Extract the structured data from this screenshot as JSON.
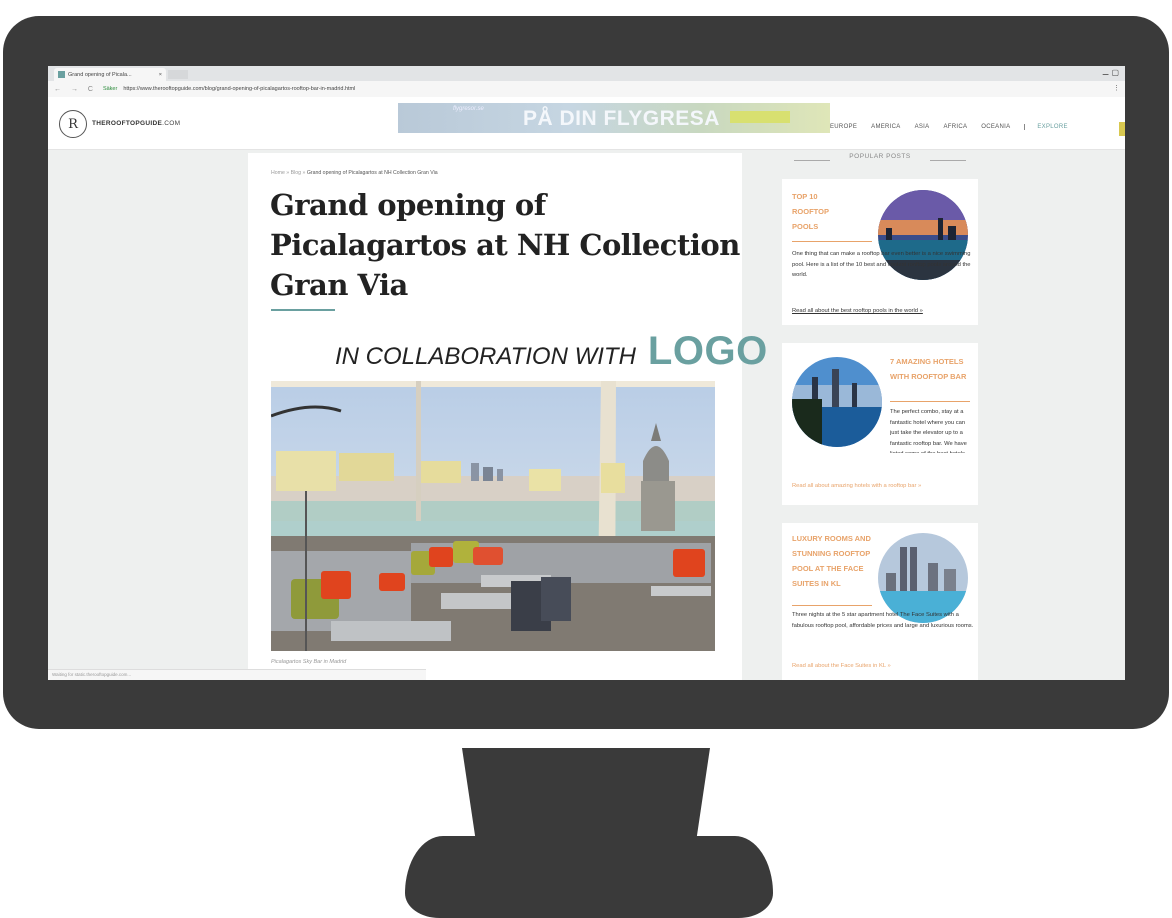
{
  "browser": {
    "tab_title": "Grand opening of Picala...",
    "tab_close": "×",
    "window_controls": "⚊ ▢",
    "nav_buttons": "← → C",
    "secure_label": "Säker",
    "url": "https://www.therooftopguide.com/blog/grand-opening-of-picalagartos-rooftop-bar-in-madrid.html",
    "menu": "⋮"
  },
  "site": {
    "logo_mark": "R",
    "logo_text_bold": "THEROOFTOPGUIDE",
    "logo_text_rest": ".COM",
    "ad_banner_sub": "flygresor.se",
    "ad_banner_text": "PÅ DIN FLYGRESA",
    "nav": [
      "EUROPE",
      "AMERICA",
      "ASIA",
      "AFRICA",
      "OCEANIA"
    ],
    "explore": "EXPLORE"
  },
  "article": {
    "breadcrumb": [
      "Home",
      "Blog",
      "Grand opening of Picalagartos at NH Collection Gran Via"
    ],
    "breadcrumb_sep": "»",
    "title": "Grand opening of Picalagartos at NH Collection Gran Via",
    "collab_text": "IN COLLABORATION WITH",
    "collab_logo": "LOGO",
    "photo_caption": "Picalagartos Sky Bar in Madrid"
  },
  "status_text": "Waiting for static.therooftopguide.com...",
  "sidebar": {
    "heading": "POPULAR POSTS",
    "cards": [
      {
        "title": "TOP 10 ROOFTOP POOLS",
        "body": "One thing that can make a rooftop bar even better is a nice swimming pool. Here is a list of the 10 best and coolest rooftop pools around the world.",
        "link": "Read all about the best rooftop pools in the world »"
      },
      {
        "title": "7 AMAZING HOTELS WITH ROOFTOP BAR",
        "body": "The perfect combo, stay at a fantastic hotel where you can just take the elevator up to a fantastic rooftop bar. We have listed some of the best hotels with rooftop bar.",
        "link": "Read all about amazing hotels with a rooftop bar »"
      },
      {
        "title": "LUXURY ROOMS AND STUNNING ROOFTOP POOL AT THE FACE SUITES IN KL",
        "body": "Three nights at the 5 star apartment hotel The Face Suites with a fabulous rooftop pool, affordable prices and large and luxurious rooms.",
        "link": "Read all about the Face Suites in KL »"
      }
    ]
  },
  "colors": {
    "bezel": "#3a3a3a",
    "accent_teal": "#6aa0a0",
    "accent_orange": "#e8a36a"
  }
}
